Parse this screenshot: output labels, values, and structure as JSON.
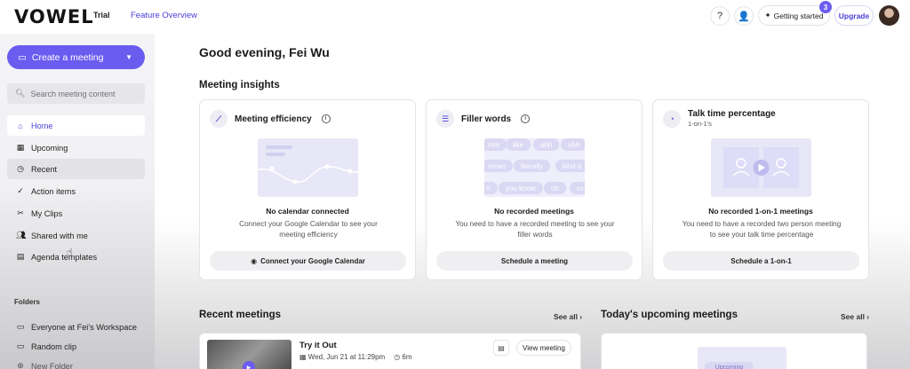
{
  "topbar": {
    "logo": "VOWEL",
    "trial": "Trial",
    "feature_overview": "Feature Overview",
    "getting_started": "Getting started",
    "getting_started_badge": "3",
    "upgrade": "Upgrade"
  },
  "sidebar": {
    "create_meeting": "Create a meeting",
    "search_placeholder": "Search meeting content",
    "nav": [
      {
        "label": "Home",
        "icon": "home-icon"
      },
      {
        "label": "Upcoming",
        "icon": "calendar-icon"
      },
      {
        "label": "Recent",
        "icon": "clock-icon"
      },
      {
        "label": "Action items",
        "icon": "check-icon"
      },
      {
        "label": "My Clips",
        "icon": "scissors-icon"
      },
      {
        "label": "Shared with me",
        "icon": "users-icon"
      },
      {
        "label": "Agenda templates",
        "icon": "document-icon"
      }
    ],
    "folders_label": "Folders",
    "folders": [
      {
        "label": "Everyone at Fei's Workspace",
        "icon": "folder-icon"
      },
      {
        "label": "Random clip",
        "icon": "folder-icon"
      },
      {
        "label": "New Folder",
        "icon": "plus-icon"
      }
    ]
  },
  "main": {
    "greeting": "Good evening, Fei Wu",
    "insights_title": "Meeting insights",
    "cards": [
      {
        "title": "Meeting efficiency",
        "subtitle": "",
        "empty_title": "No calendar connected",
        "empty_text": "Connect your Google Calendar to see your meeting efficiency",
        "button": "Connect your Google Calendar"
      },
      {
        "title": "Filler words",
        "subtitle": "",
        "empty_title": "No recorded meetings",
        "empty_text": "You need to have a recorded meeting to see your filler words",
        "button": "Schedule a meeting",
        "words": [
          "mm",
          "like",
          "ahh",
          "uhh",
          "mean",
          "literally",
          "kind o",
          "rr",
          "you know",
          "oh",
          "ru"
        ]
      },
      {
        "title": "Talk time percentage",
        "subtitle": "1-on-1's",
        "empty_title": "No recorded 1-on-1 meetings",
        "empty_text": "You need to have a recorded two person meeting to see your talk time percentage",
        "button": "Schedule a 1-on-1"
      }
    ],
    "recent_title": "Recent meetings",
    "recent_see_all": "See all ›",
    "upcoming_title": "Today's upcoming meetings",
    "upcoming_see_all": "See all ›",
    "recent_meeting": {
      "title": "Try it Out",
      "date": "Wed, Jun 21 at 11:29pm",
      "duration": "6m",
      "view_button": "View meeting"
    },
    "upcoming_chip": "Upcoming"
  }
}
